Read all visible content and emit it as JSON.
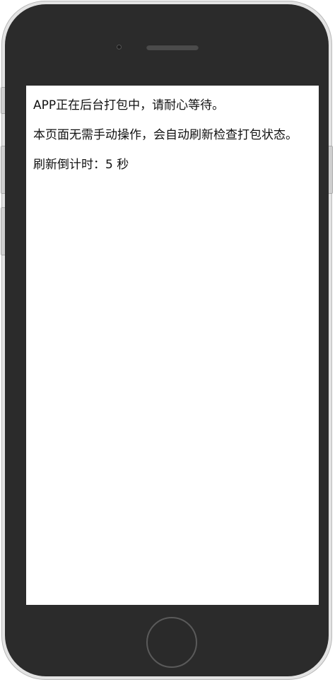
{
  "screen": {
    "message_line1": "APP正在后台打包中，请耐心等待。",
    "message_line2": "本页面无需手动操作，会自动刷新检查打包状态。",
    "countdown_label": "刷新倒计时：",
    "countdown_value": "5",
    "countdown_unit": "秒"
  },
  "device": {
    "icons": [
      "front-camera-icon",
      "speaker-grille-icon",
      "home-button-icon"
    ],
    "colors": {
      "bezel": "#2b2b2b",
      "frame": "#e3e3e3",
      "screen": "#ffffff",
      "text": "#111111"
    }
  }
}
